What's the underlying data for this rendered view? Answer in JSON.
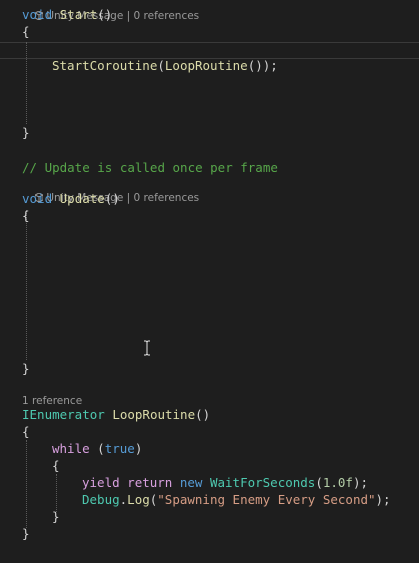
{
  "codelens": {
    "start": "Unity Message | 0 references",
    "update": "Unity Message | 0 references",
    "loop": "1 reference"
  },
  "code": {
    "start_void": "void",
    "start_name": "Start",
    "start_parens": "()",
    "start_open": "{",
    "start_call_name": "StartCoroutine",
    "start_call_open": "(",
    "start_call_arg": "LoopRoutine",
    "start_call_close": "());",
    "start_close": "}",
    "comment": "// Update is called once per frame",
    "update_void": "void",
    "update_name": "Update",
    "update_parens": "()",
    "update_open": "{",
    "update_close": "}",
    "loop_type": "IEnumerator",
    "loop_name": "LoopRoutine",
    "loop_parens": "()",
    "loop_open": "{",
    "while_kw": "while",
    "while_open": "(",
    "while_cond": "true",
    "while_close": ")",
    "while_brace_open": "{",
    "yield_kw": "yield",
    "return_kw": "return",
    "new_kw": "new",
    "wfs_type": "WaitForSeconds",
    "wfs_open": "(",
    "wfs_arg": "1.0f",
    "wfs_close": ");",
    "debug_type": "Debug",
    "debug_dot": ".",
    "log_name": "Log",
    "log_open": "(",
    "log_str": "\"Spawning Enemy Every Second\"",
    "log_close": ");",
    "while_brace_close": "}",
    "loop_close": "}"
  },
  "colors": {
    "background": "#1e1e1e",
    "keyword": "#569cd6",
    "method": "#dcdcaa",
    "type": "#4ec9b0",
    "control": "#d8a0df",
    "comment": "#57a64a",
    "string": "#d69d85",
    "number": "#b5cea8"
  },
  "icons": {
    "codelens": "unity-message-icon",
    "cursor": "text-cursor-icon"
  }
}
